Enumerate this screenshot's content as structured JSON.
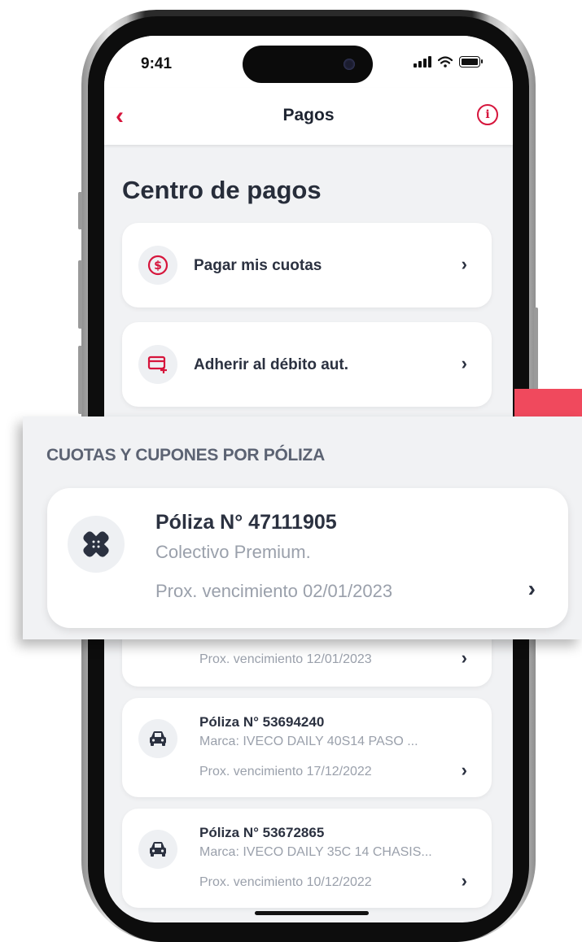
{
  "status_bar": {
    "time": "9:41"
  },
  "nav": {
    "title": "Pagos"
  },
  "page": {
    "title": "Centro de pagos"
  },
  "actions": [
    {
      "label": "Pagar mis cuotas",
      "icon": "dollar-circle-icon"
    },
    {
      "label": "Adherir al débito aut.",
      "icon": "card-plus-icon"
    }
  ],
  "policies": [
    {
      "due": "Prox. vencimiento 12/01/2023"
    },
    {
      "title": "Póliza N° 53694240",
      "subtitle": "Marca: IVECO DAILY 40S14 PASO ...",
      "due": "Prox. vencimiento 17/12/2022",
      "icon": "car-icon"
    },
    {
      "title": "Póliza N° 53672865",
      "subtitle": "Marca: IVECO DAILY 35C 14 CHASIS...",
      "due": "Prox. vencimiento 10/12/2022",
      "icon": "car-icon"
    }
  ],
  "zoom": {
    "heading": "CUOTAS Y CUPONES POR PÓLIZA",
    "policy": {
      "title": "Póliza N° 47111905",
      "subtitle": "Colectivo Premium.",
      "due": "Prox. vencimiento 02/01/2023",
      "icon": "bandage-icon"
    }
  },
  "colors": {
    "accent": "#d6153c",
    "highlight": "#f0495d",
    "text_dark": "#2b3140",
    "text_muted": "#9aa0ab",
    "background": "#f1f2f4"
  }
}
